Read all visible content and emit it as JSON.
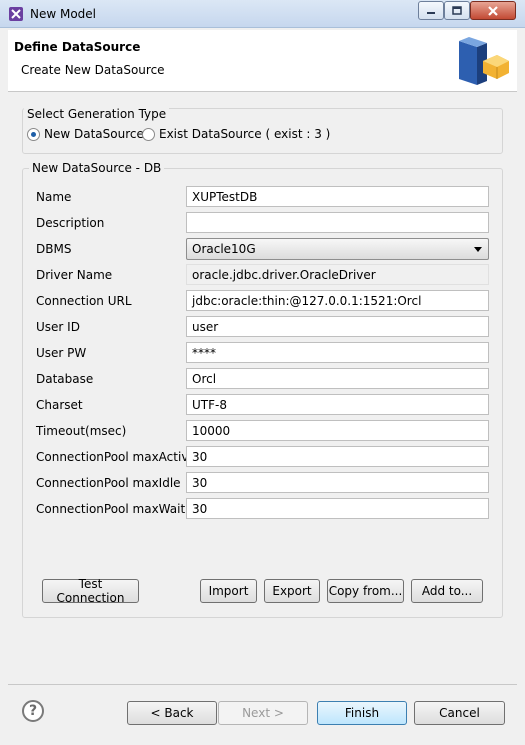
{
  "window": {
    "title": "New Model",
    "controls": {
      "minimize": "minimize-icon",
      "maximize": "maximize-icon",
      "close": "close-icon"
    }
  },
  "banner": {
    "title": "Define DataSource",
    "subtitle": "Create New DataSource"
  },
  "generation": {
    "legend": "Select Generation Type",
    "options": [
      {
        "label": "New DataSource",
        "checked": true
      },
      {
        "label": "Exist DataSource ( exist : 3 )",
        "checked": false
      }
    ]
  },
  "db": {
    "legend": "New DataSource - DB",
    "fields": [
      {
        "label": "Name",
        "value": "XUPTestDB"
      },
      {
        "label": "Description",
        "value": ""
      },
      {
        "label": "DBMS",
        "value": "Oracle10G"
      },
      {
        "label": "Driver Name",
        "value": "oracle.jdbc.driver.OracleDriver"
      },
      {
        "label": "Connection URL",
        "value": " jdbc:oracle:thin:@127.0.0.1:1521:Orcl"
      },
      {
        "label": "User ID",
        "value": "user"
      },
      {
        "label": "User PW",
        "value": "****"
      },
      {
        "label": "Database",
        "value": "Orcl"
      },
      {
        "label": "Charset",
        "value": "UTF-8"
      },
      {
        "label": "Timeout(msec)",
        "value": "10000"
      },
      {
        "label": "ConnectionPool maxActive",
        "value": "30"
      },
      {
        "label": "ConnectionPool maxIdle",
        "value": "30"
      },
      {
        "label": "ConnectionPool maxWait",
        "value": "30"
      }
    ]
  },
  "actions": {
    "test_connection": "Test Connection",
    "import": "Import",
    "export": "Export",
    "copy_from": "Copy from...",
    "add_to": "Add to..."
  },
  "footer": {
    "help": "?",
    "back": "< Back",
    "next": "Next >",
    "finish": "Finish",
    "cancel": "Cancel"
  }
}
